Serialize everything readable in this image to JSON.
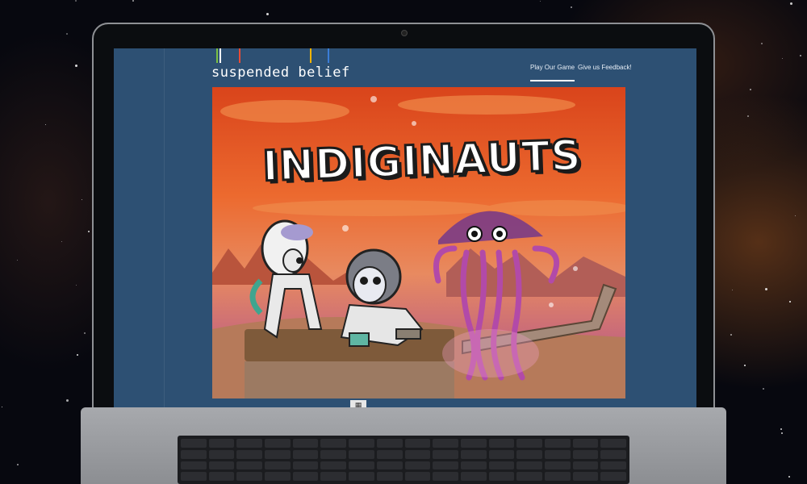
{
  "site": {
    "brand": "suspended belief",
    "nav": [
      {
        "label": "Play Our Game",
        "active": true
      },
      {
        "label": "Give us Feedback!",
        "active": false
      }
    ]
  },
  "hero": {
    "title": "INDIGINAUTS"
  },
  "colors": {
    "page_bg": "#2d5073",
    "hero_sky": "#e2582a",
    "title_text": "#ffffff"
  }
}
